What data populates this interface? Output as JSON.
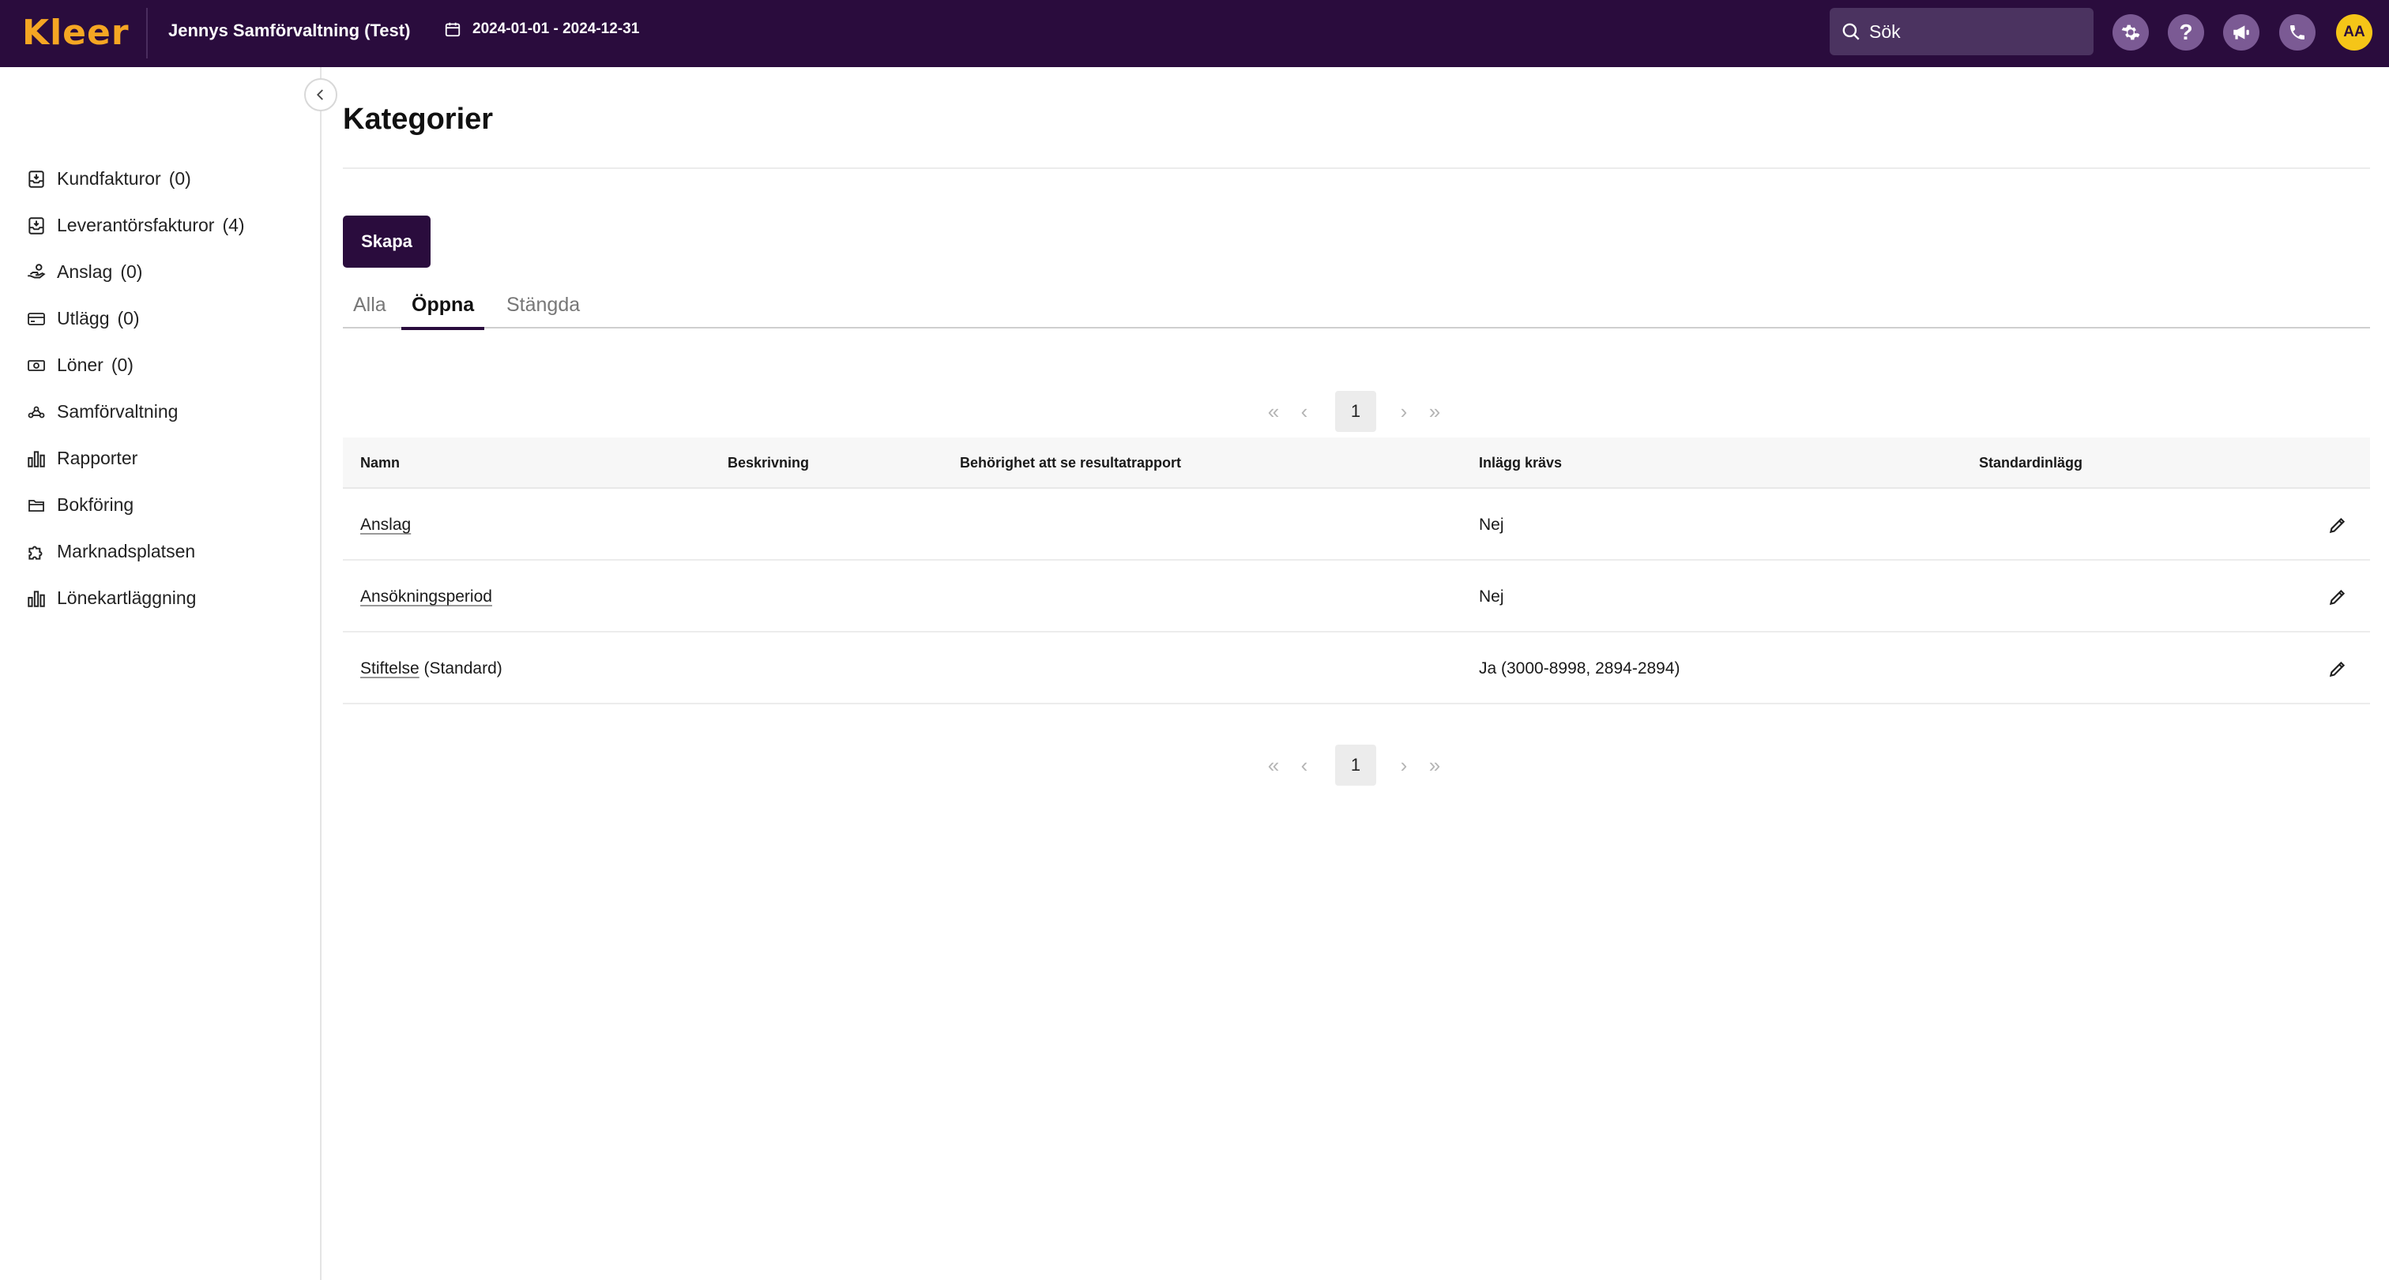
{
  "app": {
    "logo_text": "Kleer",
    "org_name": "Jennys Samförvaltning (Test)",
    "date_range": "2024-01-01 - 2024-12-31",
    "search_placeholder": "Sök",
    "avatar_initials": "AA",
    "brand_color": "#2a0c3d",
    "accent_color": "#f5a623"
  },
  "top_icons": [
    "settings-icon",
    "help-icon",
    "megaphone-icon",
    "phone-icon"
  ],
  "sidebar": {
    "items": [
      {
        "label": "Kundfakturor",
        "count": "(0)",
        "icon": "invoice-inbox-icon"
      },
      {
        "label": "Leverantörsfakturor",
        "count": "(4)",
        "icon": "invoice-inbox-icon"
      },
      {
        "label": "Anslag",
        "count": "(0)",
        "icon": "hand-coins-icon"
      },
      {
        "label": "Utlägg",
        "count": "(0)",
        "icon": "credit-card-icon"
      },
      {
        "label": "Löner",
        "count": "(0)",
        "icon": "banknote-icon"
      },
      {
        "label": "Samförvaltning",
        "count": "",
        "icon": "network-icon"
      },
      {
        "label": "Rapporter",
        "count": "",
        "icon": "bar-chart-icon"
      },
      {
        "label": "Bokföring",
        "count": "",
        "icon": "folder-icon"
      },
      {
        "label": "Marknadsplatsen",
        "count": "",
        "icon": "puzzle-icon"
      },
      {
        "label": "Lönekartläggning",
        "count": "",
        "icon": "bar-chart-icon"
      }
    ]
  },
  "main": {
    "title": "Kategorier",
    "create_label": "Skapa",
    "tabs": [
      {
        "label": "Alla",
        "active": false
      },
      {
        "label": "Öppna",
        "active": true
      },
      {
        "label": "Stängda",
        "active": false
      }
    ],
    "pagination": {
      "current_page": "1"
    },
    "table": {
      "columns": [
        "Namn",
        "Beskrivning",
        "Behörighet att se resultatrapport",
        "Inlägg krävs",
        "Standardinlägg"
      ],
      "rows": [
        {
          "name": "Anslag",
          "suffix": "",
          "description": "",
          "permission": "",
          "required": "Nej",
          "default": ""
        },
        {
          "name": "Ansökningsperiod",
          "suffix": "",
          "description": "",
          "permission": "",
          "required": "Nej",
          "default": ""
        },
        {
          "name": "Stiftelse",
          "suffix": " (Standard)",
          "description": "",
          "permission": "",
          "required": "Ja (3000-8998, 2894-2894)",
          "default": ""
        }
      ]
    }
  }
}
